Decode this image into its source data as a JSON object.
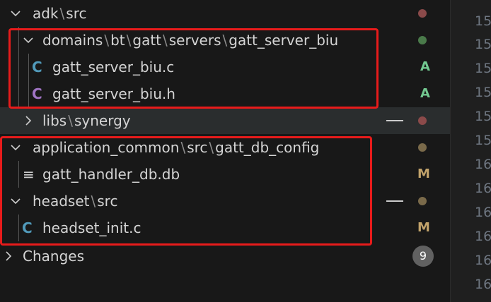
{
  "tree": {
    "rows": [
      {
        "label_parts": [
          "adk",
          "src"
        ],
        "dot": "#8b4a4a"
      },
      {
        "label_parts": [
          "domains",
          "bt",
          "gatt",
          "servers",
          "gatt_server_biu"
        ],
        "dot": "#4a7a4a"
      },
      {
        "icon": "C",
        "icon_color": "#519aba",
        "label": "gatt_server_biu.c",
        "badge": "A",
        "badge_color": "#73c991"
      },
      {
        "icon": "C",
        "icon_color": "#a074c4",
        "label": "gatt_server_biu.h",
        "badge": "A",
        "badge_color": "#73c991"
      },
      {
        "label_parts": [
          "libs",
          "synergy"
        ],
        "dot": "#8b4a4a"
      },
      {
        "label_parts": [
          "application_common",
          "src",
          "gatt_db_config"
        ],
        "dot": "#7a6a4a"
      },
      {
        "icon": "≡",
        "icon_color": "#cccccc",
        "label": "gatt_handler_db.db",
        "badge": "M",
        "badge_color": "#c2a36b"
      },
      {
        "label_parts": [
          "headset",
          "src"
        ],
        "dot": "#7a6a4a"
      },
      {
        "icon": "C",
        "icon_color": "#519aba",
        "label": "headset_init.c",
        "badge": "M",
        "badge_color": "#c2a36b"
      },
      {
        "label": "Changes",
        "count": "9"
      }
    ]
  },
  "gutter": {
    "line_numbers": [
      "15",
      "15",
      "15",
      "15",
      "15",
      "15",
      "16",
      "16",
      "16",
      "16",
      "16",
      "16"
    ]
  },
  "colors": {
    "highlight_box": "#e81b1b",
    "hover_row": "#2a2d2e"
  }
}
